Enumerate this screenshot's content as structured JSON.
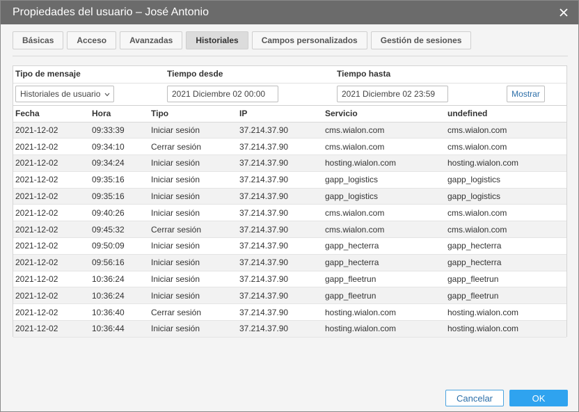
{
  "window": {
    "title": "Propiedades del usuario – José Antonio"
  },
  "tabs": [
    {
      "label": "Básicas"
    },
    {
      "label": "Acceso"
    },
    {
      "label": "Avanzadas"
    },
    {
      "label": "Historiales"
    },
    {
      "label": "Campos personalizados"
    },
    {
      "label": "Gestión de sesiones"
    }
  ],
  "filters": {
    "type_label": "Tipo de mensaje",
    "from_label": "Tiempo desde",
    "to_label": "Tiempo hasta",
    "type_value": "Historiales de usuario",
    "from_value": "2021 Diciembre 02 00:00",
    "to_value": "2021 Diciembre 02 23:59",
    "show_button": "Mostrar"
  },
  "table": {
    "columns": [
      "Fecha",
      "Hora",
      "Tipo",
      "IP",
      "Servicio",
      "undefined"
    ],
    "rows": [
      [
        "2021-12-02",
        "09:33:39",
        "Iniciar sesión",
        "37.214.37.90",
        "cms.wialon.com",
        "cms.wialon.com"
      ],
      [
        "2021-12-02",
        "09:34:10",
        "Cerrar sesión",
        "37.214.37.90",
        "cms.wialon.com",
        "cms.wialon.com"
      ],
      [
        "2021-12-02",
        "09:34:24",
        "Iniciar sesión",
        "37.214.37.90",
        "hosting.wialon.com",
        "hosting.wialon.com"
      ],
      [
        "2021-12-02",
        "09:35:16",
        "Iniciar sesión",
        "37.214.37.90",
        "gapp_logistics",
        "gapp_logistics"
      ],
      [
        "2021-12-02",
        "09:35:16",
        "Iniciar sesión",
        "37.214.37.90",
        "gapp_logistics",
        "gapp_logistics"
      ],
      [
        "2021-12-02",
        "09:40:26",
        "Iniciar sesión",
        "37.214.37.90",
        "cms.wialon.com",
        "cms.wialon.com"
      ],
      [
        "2021-12-02",
        "09:45:32",
        "Cerrar sesión",
        "37.214.37.90",
        "cms.wialon.com",
        "cms.wialon.com"
      ],
      [
        "2021-12-02",
        "09:50:09",
        "Iniciar sesión",
        "37.214.37.90",
        "gapp_hecterra",
        "gapp_hecterra"
      ],
      [
        "2021-12-02",
        "09:56:16",
        "Iniciar sesión",
        "37.214.37.90",
        "gapp_hecterra",
        "gapp_hecterra"
      ],
      [
        "2021-12-02",
        "10:36:24",
        "Iniciar sesión",
        "37.214.37.90",
        "gapp_fleetrun",
        "gapp_fleetrun"
      ],
      [
        "2021-12-02",
        "10:36:24",
        "Iniciar sesión",
        "37.214.37.90",
        "gapp_fleetrun",
        "gapp_fleetrun"
      ],
      [
        "2021-12-02",
        "10:36:40",
        "Cerrar sesión",
        "37.214.37.90",
        "hosting.wialon.com",
        "hosting.wialon.com"
      ],
      [
        "2021-12-02",
        "10:36:44",
        "Iniciar sesión",
        "37.214.37.90",
        "hosting.wialon.com",
        "hosting.wialon.com"
      ]
    ]
  },
  "footer": {
    "cancel": "Cancelar",
    "ok": "OK"
  }
}
